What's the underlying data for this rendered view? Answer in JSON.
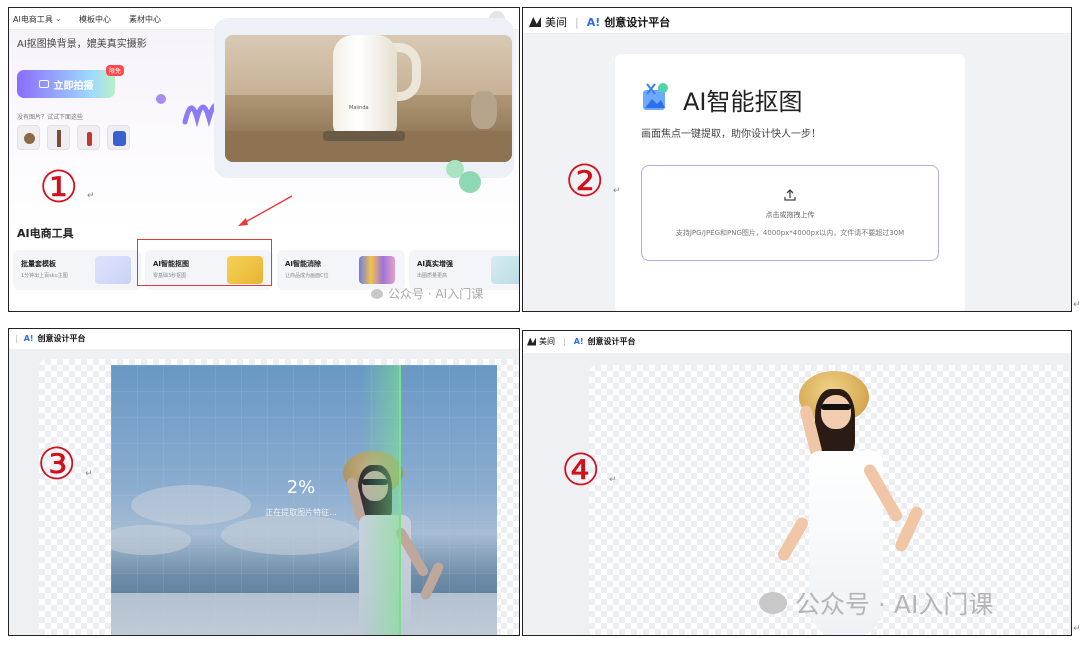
{
  "panels": [
    {
      "number": "①",
      "nav": {
        "item1": "AI电商工具",
        "item2": "模板中心",
        "item3": "素材中心"
      },
      "headline": "AI抠图换背景，媲美真实摄影",
      "shoot_button": "立即拍摄",
      "hot_badge": "限免",
      "hint": "没有图片？试试下面这些",
      "product_brand": "Malinda",
      "section_title": "AI电商工具",
      "tools": [
        {
          "title": "批量套模板",
          "subtitle": "1分钟出上百sku主图"
        },
        {
          "title": "AI智能抠图",
          "subtitle": "零基础3秒抠图"
        },
        {
          "title": "AI智能消除",
          "subtitle": "让商品成为画面C位"
        },
        {
          "title": "AI真实增强",
          "subtitle": "出图质量更高"
        }
      ],
      "watermark": "公众号 · AI入门课"
    },
    {
      "number": "②",
      "brand": {
        "mark": "美间",
        "ai": "A!",
        "name": "创意设计平台"
      },
      "title": "AI智能抠图",
      "description": "画面焦点一键提取，助你设计快人一步！",
      "upload_label": "点击或拖拽上传",
      "upload_hint": "支持JPG/JPEG和PNG图片，4000px*4000px以内，文件请不要超过30M"
    },
    {
      "number": "③",
      "brand": {
        "ai": "A!",
        "name": "创意设计平台"
      },
      "progress_text": "2%",
      "progress": 0.02,
      "status": "正在提取图片特征..."
    },
    {
      "number": "④",
      "brand": {
        "mark": "美间",
        "ai": "A!",
        "name": "创意设计平台"
      },
      "watermark": "公众号 · AI入门课"
    }
  ],
  "para_mark": "↵",
  "colors": {
    "circled_numbers": "#d0101a",
    "highlight_box": "#e63a3a",
    "brand_ai": "#2e6bff",
    "scan_line": "#7de08a"
  }
}
